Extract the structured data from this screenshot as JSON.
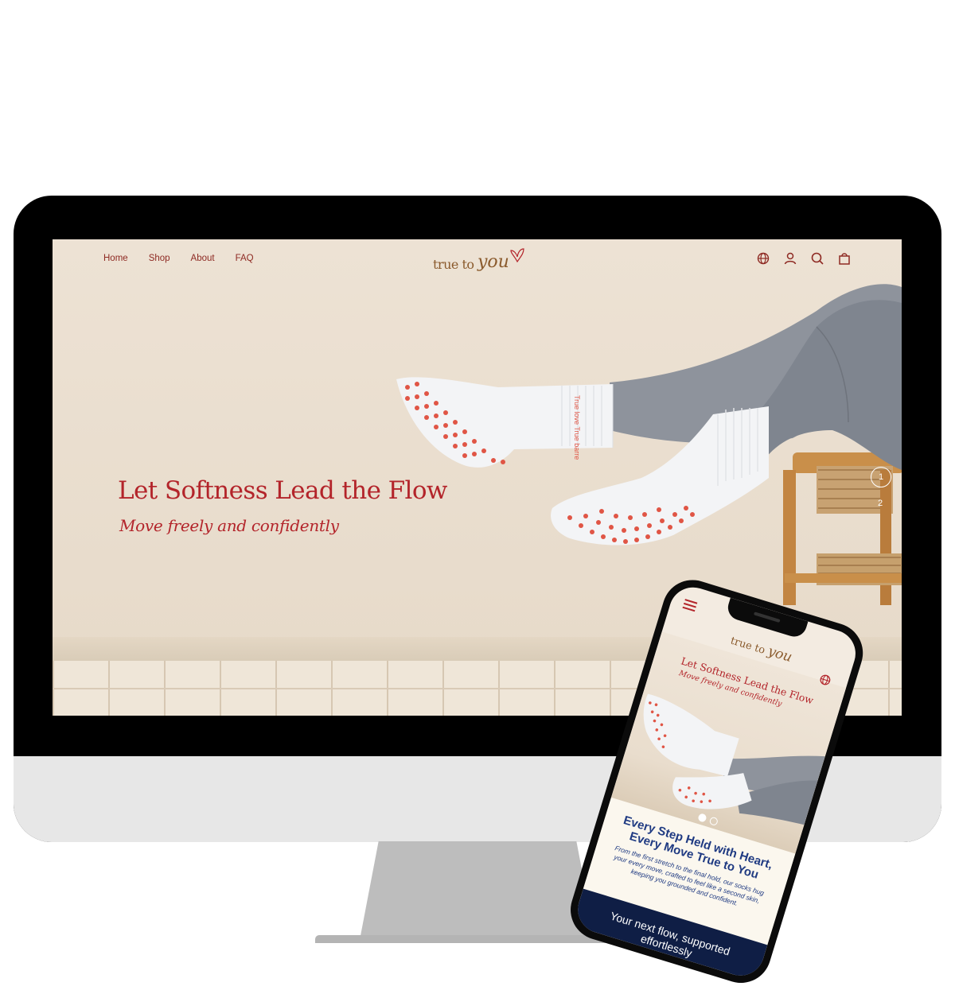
{
  "desktop": {
    "nav": {
      "home": "Home",
      "shop": "Shop",
      "about": "About",
      "faq": "FAQ"
    },
    "logo": {
      "text": "true to",
      "script": "you"
    },
    "hero": {
      "title": "Let Softness Lead the Flow",
      "subtitle": "Move freely and confidently",
      "sock_text": "True love True barre"
    },
    "slides": {
      "current": "1",
      "next": "2"
    },
    "icons": [
      "globe-icon",
      "account-icon",
      "search-icon",
      "cart-icon"
    ]
  },
  "mobile": {
    "logo": {
      "text": "true to",
      "script": "you"
    },
    "hero": {
      "title": "Let Softness Lead the Flow",
      "subtitle": "Move freely and confidently"
    },
    "section": {
      "heading": "Every Step Held with Heart, Every Move True to You",
      "body": "From the first stretch to the final hold, our socks hug your every move, crafted to feel like a second skin, keeping you grounded and confident."
    },
    "banner": "Your next flow, supported effortlessly"
  },
  "colors": {
    "brand_red": "#b3242a",
    "logo_brown": "#8a5a2c",
    "heading_blue": "#1f3a82",
    "navy": "#0f1e45",
    "sock_dots": "#e05545",
    "leggings": "#8a909a"
  }
}
